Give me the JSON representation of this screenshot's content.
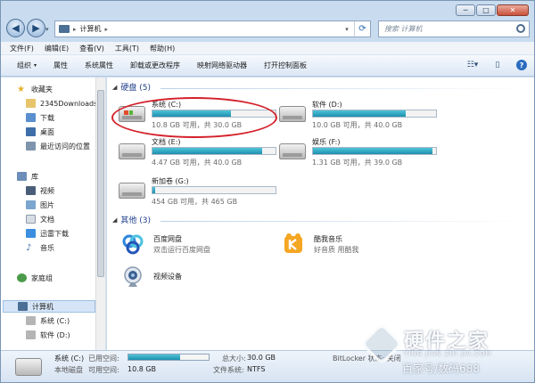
{
  "window": {
    "caption_buttons": {
      "minimize": "─",
      "maximize": "□",
      "close": "✕"
    }
  },
  "address": {
    "path": "计算机",
    "search_placeholder": "搜索 计算机"
  },
  "menubar": [
    "文件(F)",
    "编辑(E)",
    "查看(V)",
    "工具(T)",
    "帮助(H)"
  ],
  "toolbar": [
    {
      "label": "组织",
      "dropdown": true
    },
    {
      "label": "属性"
    },
    {
      "label": "系统属性"
    },
    {
      "label": "卸载或更改程序"
    },
    {
      "label": "映射网络驱动器"
    },
    {
      "label": "打开控制面板"
    }
  ],
  "sidebar": {
    "favorites": {
      "label": "收藏夹",
      "items": [
        "2345Downloads",
        "下载",
        "桌面",
        "最近访问的位置"
      ]
    },
    "libraries": {
      "label": "库",
      "items": [
        "视频",
        "图片",
        "文档",
        "迅雷下载",
        "音乐"
      ]
    },
    "homegroup": {
      "label": "家庭组"
    },
    "computer": {
      "label": "计算机",
      "items": [
        "系统 (C:)",
        "软件 (D:)"
      ]
    }
  },
  "groups": {
    "hard_disks": {
      "label": "硬盘 (5)"
    },
    "other": {
      "label": "其他 (3)"
    }
  },
  "drives": [
    {
      "name": "系统 (C:)",
      "info": "10.8 GB 可用，共 30.0 GB",
      "used_fraction": 0.64
    },
    {
      "name": "软件 (D:)",
      "info": "10.0 GB 可用，共 40.0 GB",
      "used_fraction": 0.75
    },
    {
      "name": "文档 (E:)",
      "info": "4.47 GB 可用，共 40.0 GB",
      "used_fraction": 0.89
    },
    {
      "name": "娱乐 (F:)",
      "info": "1.31 GB 可用，共 39.0 GB",
      "used_fraction": 0.97
    },
    {
      "name": "新加卷 (G:)",
      "info": "454 GB 可用，共 465 GB",
      "used_fraction": 0.02
    }
  ],
  "others": [
    {
      "name": "百度网盘",
      "desc": "双击运行百度网盘"
    },
    {
      "name": "酷我音乐",
      "desc": "好音质 用酷我"
    },
    {
      "name": "视频设备",
      "desc": ""
    }
  ],
  "details": {
    "name": "系统 (C:)",
    "type": "本地磁盘",
    "used_label": "已用空间:",
    "free_label": "可用空间:",
    "free_value": "10.8 GB",
    "total_label": "总大小:",
    "total_value": "30.0 GB",
    "fs_label": "文件系统:",
    "fs_value": "NTFS",
    "bitlocker": "BitLocker 状态: 关闭",
    "used_fraction": 0.64
  },
  "watermark": {
    "brand": "硬件之家",
    "url": "YING JIAN ZHI JIA.COM",
    "tag": "百家号/数码688"
  },
  "colors": {
    "accent_blue": "#1e3f8a",
    "bar_fill": "#1d8fae",
    "highlight_oval": "#d4202a"
  }
}
